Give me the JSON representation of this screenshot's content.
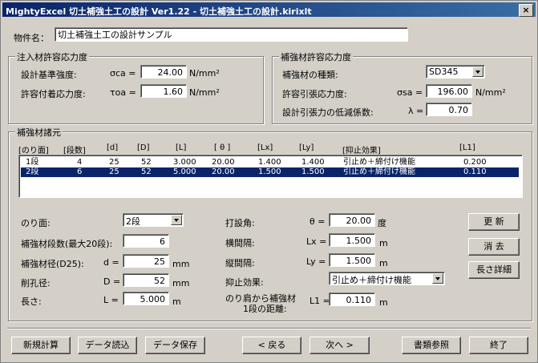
{
  "title": "MightyExcel 切土補強土工の設計 Ver1.22 - 切土補強土工の設計.kirixlt",
  "close_label": "×",
  "property": {
    "label": "物件名：",
    "value": "切土補強土工の設計サンプル"
  },
  "grout": {
    "caption": "注入材許容応力度",
    "design_strength_label": "設計基準強度:",
    "design_strength_sym": "σca =",
    "design_strength_value": "24.00",
    "design_strength_unit": "N/mm²",
    "bond_label": "許容付着応力度:",
    "bond_sym": "τoa =",
    "bond_value": "1.60",
    "bond_unit": "N/mm²"
  },
  "steel": {
    "caption": "補強材許容応力度",
    "type_label": "補強材の種類:",
    "type_value": "SD345",
    "tensile_label": "許容引張応力度:",
    "tensile_sym": "σsa =",
    "tensile_value": "196.00",
    "tensile_unit": "N/mm²",
    "reduction_label": "設計引張力の低減係数:",
    "reduction_sym": "λ =",
    "reduction_value": "0.70"
  },
  "specs": {
    "caption": "補強材諸元",
    "headers": [
      "[のり面]",
      "[段数]",
      "[d]",
      "[D]",
      "[L]",
      "[ θ ]",
      "[Lx]",
      "[Ly]",
      "[抑止効果]",
      "[L1]"
    ],
    "rows": [
      {
        "slope": "1段",
        "count": "4",
        "d": "25",
        "D": "52",
        "L": "3.000",
        "theta": "20.00",
        "lx": "1.400",
        "ly": "1.400",
        "effect": "引止め＋締付け機能",
        "l1": "0.200"
      },
      {
        "slope": "2段",
        "count": "6",
        "d": "25",
        "D": "52",
        "L": "5.000",
        "theta": "20.00",
        "lx": "1.500",
        "ly": "1.500",
        "effect": "引止め＋締付け機能",
        "l1": "0.110"
      }
    ]
  },
  "detail": {
    "slope_label": "のり面:",
    "slope_value": "2段",
    "count_label": "補強材段数(最大20段):",
    "count_value": "6",
    "dia_label": "補強材径(D25):",
    "dia_sym": "d =",
    "dia_value": "25",
    "dia_unit": "mm",
    "hole_label": "削孔径:",
    "hole_sym": "D =",
    "hole_value": "52",
    "hole_unit": "mm",
    "len_label": "長さ:",
    "len_sym": "L =",
    "len_value": "5.000",
    "len_unit": "m",
    "angle_label": "打設角:",
    "angle_sym": "θ =",
    "angle_value": "20.00",
    "angle_unit": "度",
    "hspace_label": "横間隔:",
    "hspace_sym": "Lx =",
    "hspace_value": "1.500",
    "hspace_unit": "m",
    "vspace_label": "縦間隔:",
    "vspace_sym": "Ly =",
    "vspace_value": "1.500",
    "vspace_unit": "m",
    "effect_label": "抑止効果:",
    "effect_value": "引止め＋締付け機能",
    "dist_label1": "のり肩から補強材",
    "dist_label2": "1段の距離:",
    "dist_sym": "L1 =",
    "dist_value": "0.110",
    "dist_unit": "m"
  },
  "side_buttons": {
    "update": "更 新",
    "delete": "消 去",
    "length_detail": "長さ詳細"
  },
  "footer": {
    "new_calc": "新規計算",
    "load": "データ読込",
    "save": "データ保存",
    "back": "< 戻る",
    "next": "次へ >",
    "docs": "書類参照",
    "exit": "終了"
  }
}
